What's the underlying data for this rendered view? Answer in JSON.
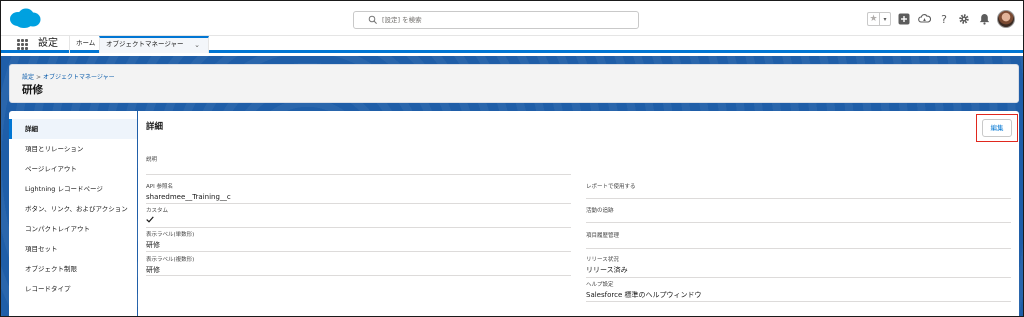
{
  "header": {
    "search_placeholder": "[設定] を検索",
    "icons": [
      "salesforce-cloud-logo",
      "favorite-star-icon",
      "favorite-dropdown-icon",
      "global-add-icon",
      "trailhead-icon",
      "help-icon",
      "setup-gear-icon",
      "notifications-bell-icon",
      "user-avatar"
    ]
  },
  "context_bar": {
    "app_name": "設定",
    "tabs": [
      {
        "label": "ホーム"
      },
      {
        "label": "オブジェクトマネージャー"
      }
    ]
  },
  "page_header": {
    "breadcrumb": [
      {
        "label": "設定"
      },
      {
        "label": "オブジェクトマネージャー"
      }
    ],
    "breadcrumb_separator": ">",
    "title": "研修"
  },
  "sidebar": {
    "items": [
      {
        "label": "詳細"
      },
      {
        "label": "項目とリレーション"
      },
      {
        "label": "ページレイアウト"
      },
      {
        "label": "Lightning レコードページ"
      },
      {
        "label": "ボタン、リンク、およびアクション"
      },
      {
        "label": "コンパクトレイアウト"
      },
      {
        "label": "項目セット"
      },
      {
        "label": "オブジェクト制限"
      },
      {
        "label": "レコードタイプ"
      }
    ],
    "active_index": 0
  },
  "details": {
    "title": "詳細",
    "edit_label": "編集",
    "highlight_color": "#e0281e",
    "left_fields": [
      {
        "label": "説明",
        "value": ""
      },
      {
        "label": "API 参照名",
        "value": "sharedmee__Training__c"
      },
      {
        "label": "カスタム",
        "value": "checked"
      },
      {
        "label": "表示ラベル(単数形)",
        "value": "研修"
      },
      {
        "label": "表示ラベル(複数形)",
        "value": "研修"
      }
    ],
    "right_fields": [
      {
        "label": "レポートで使用する",
        "value": ""
      },
      {
        "label": "活動の追跡",
        "value": ""
      },
      {
        "label": "項目履歴管理",
        "value": ""
      },
      {
        "label": "リリース状況",
        "value": "リリース済み"
      },
      {
        "label": "ヘルプ設定",
        "value": "Salesforce 標準のヘルプウィンドウ"
      }
    ]
  },
  "colors": {
    "brand_blue": "#0176d3",
    "band_blue": "#1f5ea8",
    "link_blue": "#0b5cab"
  }
}
